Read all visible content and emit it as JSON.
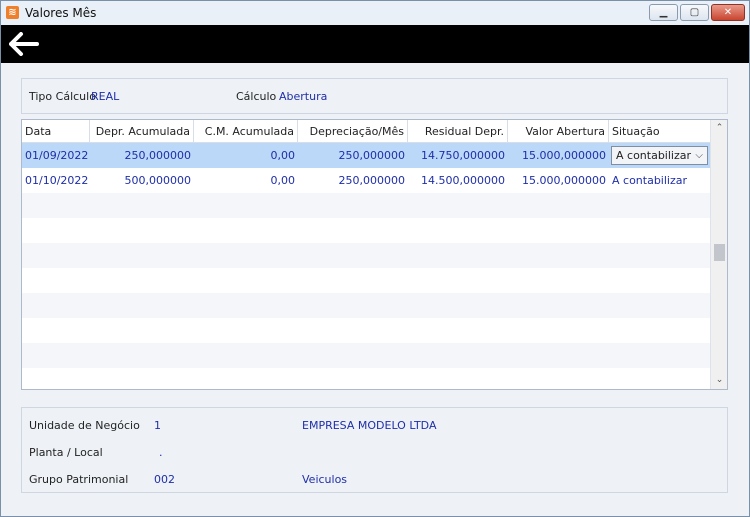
{
  "window": {
    "title": "Valores Mês"
  },
  "toolbar": {
    "back_icon": "arrow-left-icon"
  },
  "header": {
    "tipo_calculo_label": "Tipo Cálculo",
    "tipo_calculo_value": "REAL",
    "calculo_label": "Cálculo",
    "calculo_value": "Abertura"
  },
  "grid": {
    "columns": [
      "Data",
      "Depr. Acumulada",
      "C.M. Acumulada",
      "Depreciação/Mês",
      "Residual Depr.",
      "Valor Abertura",
      "Situação"
    ],
    "rows": [
      {
        "data": "01/09/2022",
        "depr_acumulada": "250,000000",
        "cm_acumulada": "0,00",
        "depreciacao_mes": "250,000000",
        "residual_depr": "14.750,000000",
        "valor_abertura": "15.000,000000",
        "situacao": "A contabilizar"
      },
      {
        "data": "01/10/2022",
        "depr_acumulada": "500,000000",
        "cm_acumulada": "0,00",
        "depreciacao_mes": "250,000000",
        "residual_depr": "14.500,000000",
        "valor_abertura": "15.000,000000",
        "situacao": "A contabilizar"
      }
    ]
  },
  "footer": {
    "unidade_label": "Unidade de Negócio",
    "unidade_code": "1",
    "unidade_name": "EMPRESA MODELO LTDA",
    "planta_label": "Planta / Local",
    "planta_value": ".",
    "grupo_label": "Grupo Patrimonial",
    "grupo_code": "002",
    "grupo_name": "Veiculos"
  }
}
